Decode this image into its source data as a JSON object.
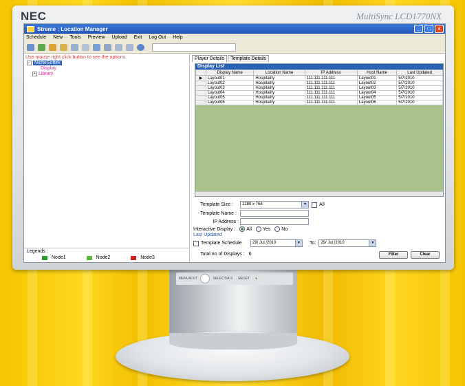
{
  "monitor": {
    "brand": "NEC",
    "model": "MultiSync LCD1770NX",
    "controls": [
      "MENU/EXIT",
      "SELECT/A-S",
      "RESET"
    ]
  },
  "window": {
    "title": "Streme : Location Manager",
    "buttons": [
      "_",
      "□",
      "×"
    ]
  },
  "menu": [
    "Schedule",
    "New",
    "Tools",
    "Preview",
    "Upload",
    "Exit",
    "Log Out",
    "Help"
  ],
  "left": {
    "hint": "Use mouse right click button to see the options.",
    "tree": {
      "root": "NicheSoftek",
      "display": "Display",
      "library": "Library"
    },
    "legend": {
      "title": "Legends :",
      "items": [
        {
          "label": "Node1",
          "color": "#2e9e2e"
        },
        {
          "label": "Node2",
          "color": "#58b83a"
        },
        {
          "label": "Node3",
          "color": "#d02020"
        }
      ]
    }
  },
  "tabs": [
    {
      "label": "Player Details",
      "active": true
    },
    {
      "label": "Template Details",
      "active": false
    }
  ],
  "display_list": {
    "title": "Display List",
    "columns": [
      "Display Name",
      "Location Name",
      "IP Address",
      "Host Name",
      "Last Updated"
    ],
    "rows": [
      [
        "Layout01",
        "Hospitality",
        "111.111.111.111",
        "Layout01",
        "5/7/2010"
      ],
      [
        "Layout02",
        "Hospitality",
        "111.111.111.111",
        "Layout02",
        "5/7/2010"
      ],
      [
        "Layout03",
        "Hospitality",
        "111.111.111.111",
        "Layout03",
        "5/7/2010"
      ],
      [
        "Layout04",
        "Hospitality",
        "111.111.111.111",
        "Layout04",
        "5/7/2010"
      ],
      [
        "Layout05",
        "Hospitality",
        "111.111.111.111",
        "Layout05",
        "5/7/2010"
      ],
      [
        "Layout06",
        "Hospitality",
        "111.111.111.111",
        "Layout06",
        "5/7/2010"
      ]
    ]
  },
  "form": {
    "template_size_label": "Template Size :",
    "template_size_value": "1280 x 768",
    "all_label": "All",
    "template_name_label": "Template Name :",
    "ip_label": "IP Address :",
    "interactive_label": "Interactive Display :",
    "radio_all": "All",
    "radio_yes": "Yes",
    "radio_no": "No",
    "last_updated": "Last Updated",
    "template_schedule": "Template Schedule",
    "from_date": "29/ Jul /2010",
    "to_label": "To:",
    "to_date": "29/ Jul /2010",
    "total_label": "Total no of Displays :",
    "total_value": "6",
    "filter_button": "Filter",
    "clear_button": "Clear"
  }
}
